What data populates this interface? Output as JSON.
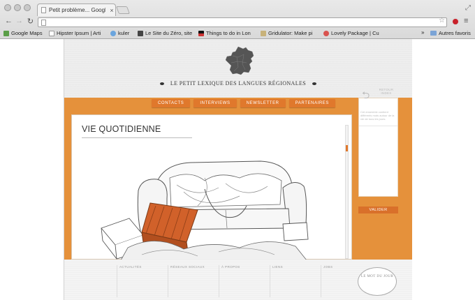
{
  "browser": {
    "tab_title": "Petit problème... Google Ch",
    "tab_close": "×",
    "bookmarks": [
      {
        "label": "Google Maps",
        "color": "#5a9e47"
      },
      {
        "label": "Hipster Ipsum | Arti",
        "color": "#ffffff"
      },
      {
        "label": "kuler",
        "color": "#6aa5de"
      },
      {
        "label": "Le Site du Zéro, site",
        "color": "#444444"
      },
      {
        "label": "Things to do in Lon",
        "color": "#111111"
      },
      {
        "label": "Gridulator: Make pi",
        "color": "#c8b27a"
      },
      {
        "label": "Lovely Package | Cu",
        "color": "#d9534f"
      }
    ],
    "bookmarks_more": "»",
    "bookmarks_folder": "Autres favoris"
  },
  "site": {
    "title": "LE PETIT LEXIQUE DES LANGUES RÉGIONALES",
    "accent_color": "#e5913b",
    "nav": [
      "CONTACTS",
      "INTERVIEWS",
      "NEWSLETTER",
      "PARTENAIRES"
    ],
    "content_title": "VIE QUOTIDIENNE",
    "side": {
      "back_label": "RETOUR INDEX",
      "description": "Cet ensemble contient différents mots autour de la vie de tous les jours.",
      "validate_button": "VALIDER"
    },
    "footer": [
      "ACTUALITÉS",
      "RÉSEAUX SOCIAUX",
      "À PROPOS",
      "LIENS",
      "JOBS"
    ],
    "word_of_day": "LE MOT DU JOUR"
  }
}
